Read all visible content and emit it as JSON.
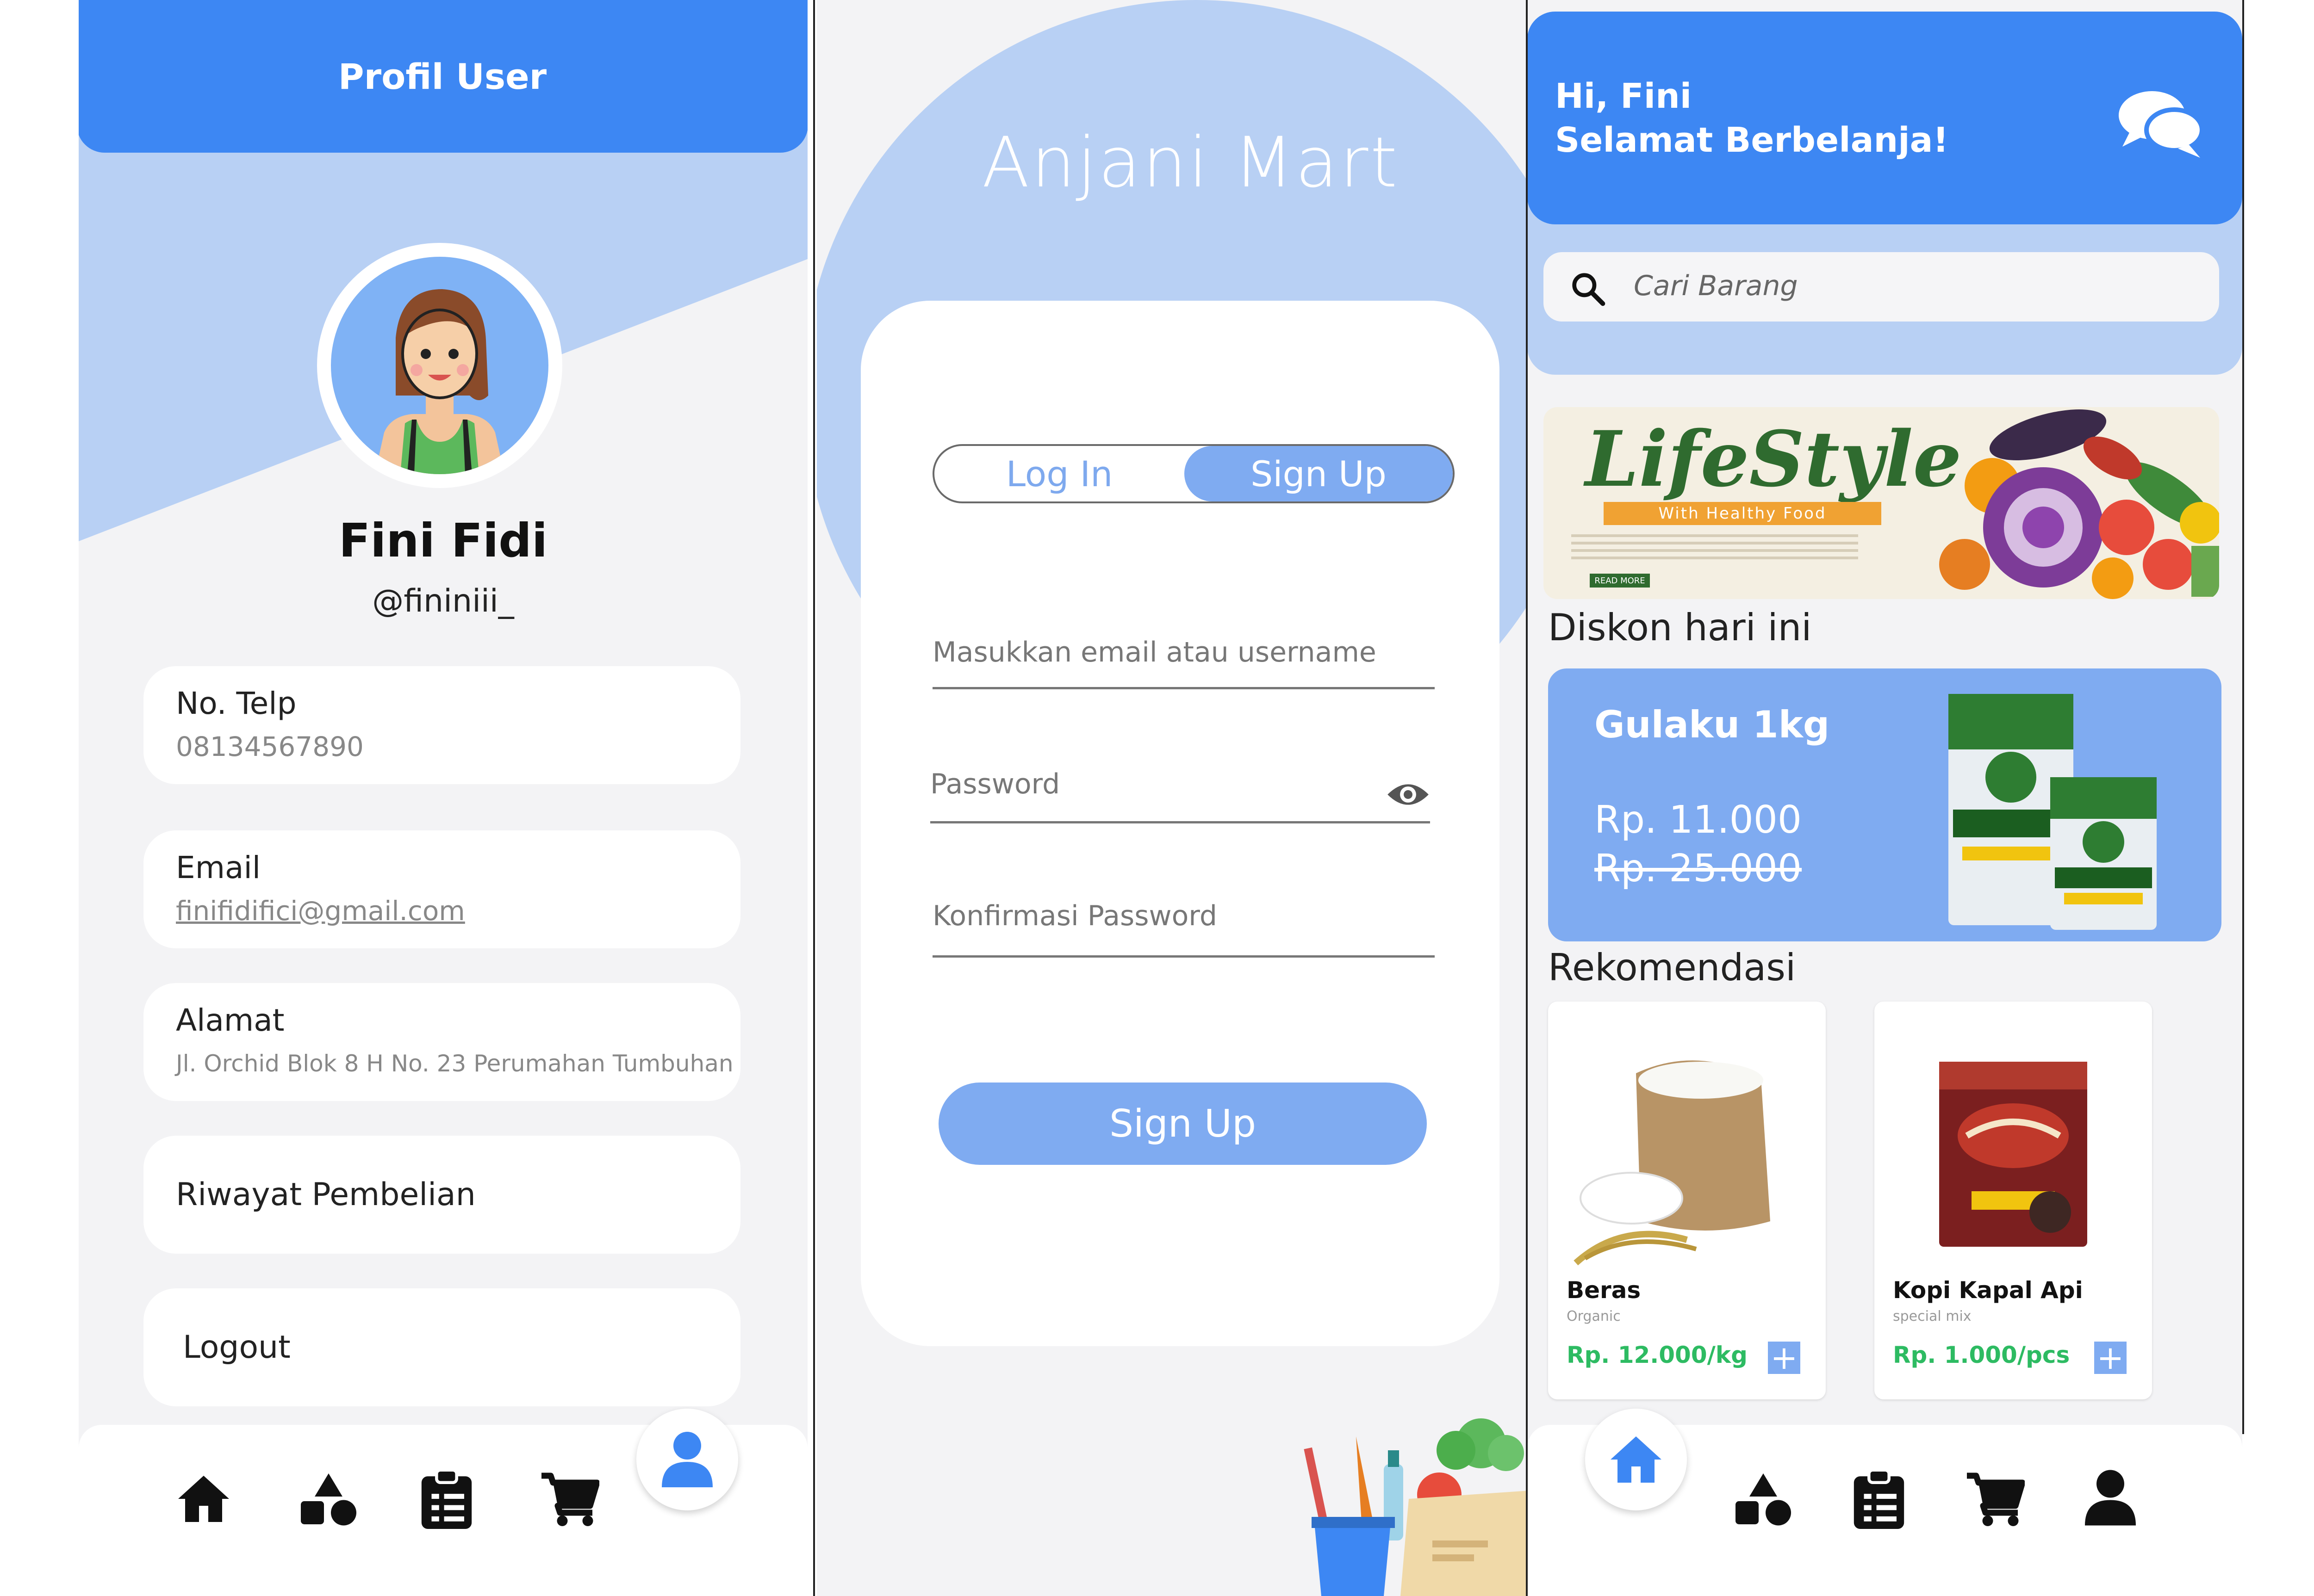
{
  "profile": {
    "header_title": "Profil User",
    "name": "Fini Fidi",
    "username": "@fininiii_",
    "phone_label": "No. Telp",
    "phone_value": "08134567890",
    "email_label": "Email",
    "email_value": "finifidifici@gmail.com",
    "address_label": "Alamat",
    "address_value": "Jl. Orchid Blok 8 H No. 23 Perumahan Tumbuhan",
    "history_label": "Riwayat Pembelian",
    "logout_label": "Logout"
  },
  "auth": {
    "app_title": "Anjani Mart",
    "tab_login": "Log In",
    "tab_signup": "Sign Up",
    "active_tab": "Sign Up",
    "email_placeholder": "Masukkan email atau username",
    "password_placeholder": "Password",
    "confirm_placeholder": "Konfirmasi Password",
    "submit_label": "Sign Up"
  },
  "home": {
    "greeting_line1": "Hi, Fini",
    "greeting_line2": "Selamat Berbelanja!",
    "search_placeholder": "Cari Barang",
    "banner": {
      "title": "LifeStyle",
      "subtitle": "With Healthy Food",
      "cta": "READ MORE"
    },
    "discount_title": "Diskon hari ini",
    "promo": {
      "name": "Gulaku 1kg",
      "price": "Rp. 11.000",
      "old_price": "Rp. 25.000"
    },
    "recommend_title": "Rekomendasi",
    "products": [
      {
        "name": "Beras",
        "subtitle": "Organic",
        "price": "Rp. 12.000/kg"
      },
      {
        "name": "Kopi Kapal Api",
        "subtitle": "special mix",
        "price": "Rp. 1.000/pcs"
      }
    ],
    "add_symbol": "+"
  },
  "colors": {
    "primary": "#3d87f3",
    "light_blue": "#b8d0f4",
    "button_blue": "#7fabf1",
    "price_green": "#2dbb62",
    "background": "#f3f3f5"
  },
  "icons": {
    "nav": [
      "home-icon",
      "categories-icon",
      "orders-icon",
      "cart-icon",
      "user-icon"
    ],
    "header": "chat-icon",
    "search": "search-icon",
    "password": "eye-icon"
  }
}
